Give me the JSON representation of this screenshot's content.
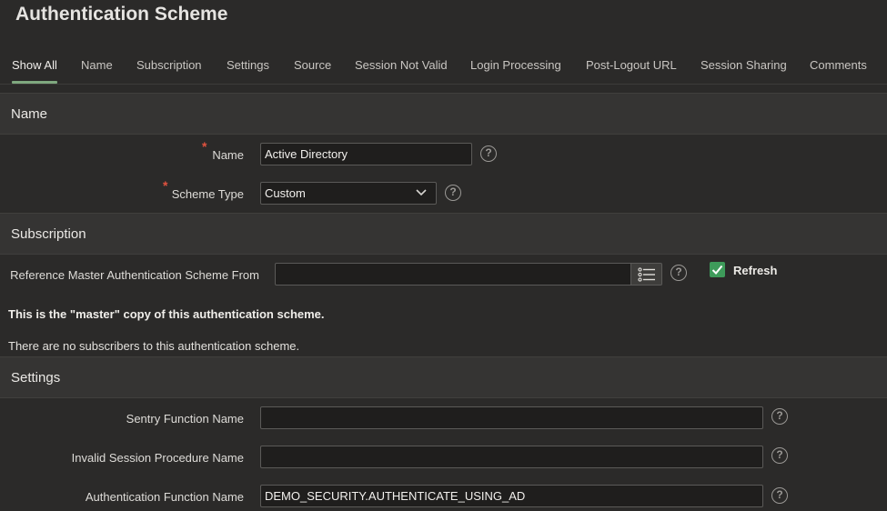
{
  "page": {
    "title": "Authentication Scheme"
  },
  "tabs": [
    {
      "label": "Show All"
    },
    {
      "label": "Name"
    },
    {
      "label": "Subscription"
    },
    {
      "label": "Settings"
    },
    {
      "label": "Source"
    },
    {
      "label": "Session Not Valid"
    },
    {
      "label": "Login Processing"
    },
    {
      "label": "Post-Logout URL"
    },
    {
      "label": "Session Sharing"
    },
    {
      "label": "Comments"
    }
  ],
  "sections": {
    "name": {
      "header": "Name",
      "name_label": "Name",
      "name_value": "Active Directory",
      "scheme_type_label": "Scheme Type",
      "scheme_type_value": "Custom"
    },
    "subscription": {
      "header": "Subscription",
      "reference_label": "Reference Master Authentication Scheme From",
      "reference_value": "",
      "refresh_label": "Refresh",
      "refresh_checked": true,
      "master_note": "This is the \"master\" copy of this authentication scheme.",
      "subscribers_note": "There are no subscribers to this authentication scheme."
    },
    "settings": {
      "header": "Settings",
      "sentry_label": "Sentry Function Name",
      "sentry_value": "",
      "invalid_session_label": "Invalid Session Procedure Name",
      "invalid_session_value": "",
      "auth_function_label": "Authentication Function Name",
      "auth_function_value": "DEMO_SECURITY.AUTHENTICATE_USING_AD"
    }
  },
  "colors": {
    "background": "#2b2a29",
    "section_header": "#353433",
    "active_tab_underline": "#7fa87f",
    "required_marker": "#e0523f",
    "checkbox": "#3e9b5a"
  },
  "icons": {
    "help": "help-circle-icon",
    "lov": "list-icon",
    "chevron": "chevron-down-icon",
    "check": "check-icon"
  }
}
